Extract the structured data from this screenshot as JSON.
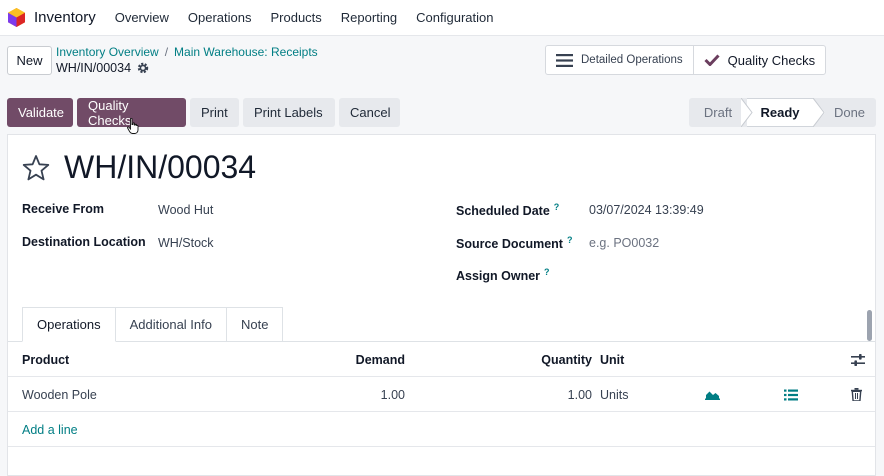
{
  "nav": {
    "app_name": "Inventory",
    "items": [
      "Overview",
      "Operations",
      "Products",
      "Reporting",
      "Configuration"
    ]
  },
  "control": {
    "new_label": "New",
    "breadcrumb": [
      "Inventory Overview",
      "Main Warehouse: Receipts"
    ],
    "record_name": "WH/IN/00034",
    "smart_buttons": [
      "Detailed Operations",
      "Quality Checks"
    ]
  },
  "actions": {
    "validate": "Validate",
    "quality_checks": "Quality Checks",
    "print": "Print",
    "print_labels": "Print Labels",
    "cancel": "Cancel"
  },
  "status": {
    "stages": [
      "Draft",
      "Ready",
      "Done"
    ],
    "current": "Ready"
  },
  "form": {
    "title": "WH/IN/00034",
    "receive_from_label": "Receive From",
    "receive_from": "Wood Hut",
    "destination_label": "Destination Location",
    "destination": "WH/Stock",
    "scheduled_date_label": "Scheduled Date",
    "scheduled_date": "03/07/2024 13:39:49",
    "source_document_label": "Source Document",
    "source_document_placeholder": "e.g. PO0032",
    "assign_owner_label": "Assign Owner",
    "help_mark": "?"
  },
  "tabs": [
    "Operations",
    "Additional Info",
    "Note"
  ],
  "table": {
    "headers": {
      "product": "Product",
      "demand": "Demand",
      "quantity": "Quantity",
      "unit": "Unit"
    },
    "rows": [
      {
        "product": "Wooden Pole",
        "demand": "1.00",
        "quantity": "1.00",
        "unit": "Units"
      }
    ],
    "add_line": "Add a line"
  },
  "colors": {
    "primary": "#714b67",
    "link": "#017e84"
  }
}
